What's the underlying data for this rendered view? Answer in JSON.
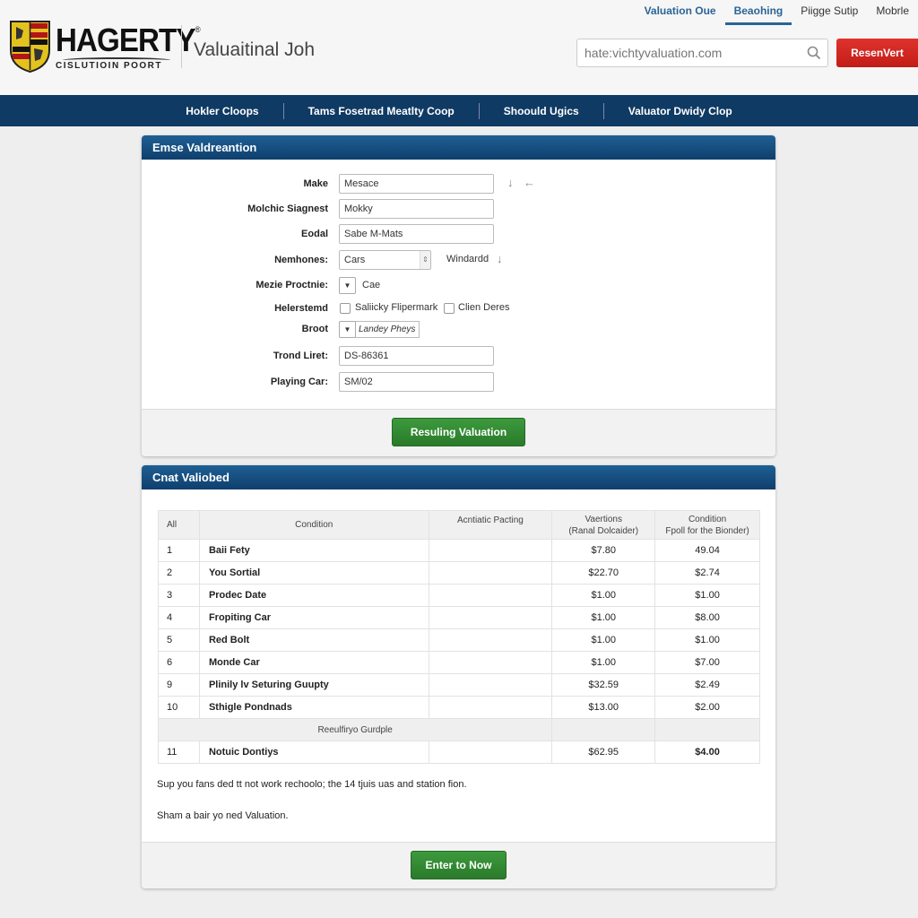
{
  "header": {
    "brand": "HAGERTY",
    "brand_tagline": "CISLUTIOIN POORT",
    "page_title": "Valuaitinal Joh",
    "top_nav": [
      {
        "label": "Valuation Oue"
      },
      {
        "label": "Beaohing",
        "active": true
      },
      {
        "label": "Piigge Sutip"
      },
      {
        "label": "Mobrle"
      }
    ],
    "search": {
      "placeholder": "hate:vichtyvaluation.com",
      "value": ""
    },
    "action_button": "ResenVert"
  },
  "main_nav": [
    "Hokler Cloops",
    "Tams Fosetrad Meatlty Coop",
    "Shoould Ugics",
    "Valuator Dwidy Clop"
  ],
  "form_panel": {
    "title": "Emse Valdreantion",
    "fields": {
      "make": {
        "label": "Make",
        "value": "Mesace"
      },
      "model_stage": {
        "label": "Molchic Siagnest",
        "value": "Mokky"
      },
      "edal": {
        "label": "Eodal",
        "value": "Sabe M-Mats"
      },
      "nemhones": {
        "label": "Nemhones:",
        "value": "Cars",
        "extra_label": "Windardd"
      },
      "mezie_proctnie": {
        "label": "Mezie Proctnie:",
        "value": "Cae"
      },
      "helerstemd": {
        "label": "Helerstemd",
        "options": [
          {
            "label": "Saliicky Flipermark",
            "checked": false
          },
          {
            "label": "Clien Deres",
            "checked": false
          }
        ]
      },
      "broot": {
        "label": "Broot",
        "value": "Landey Pheys"
      },
      "trand_liret": {
        "label": "Trond Liret:",
        "value": "DS-86361"
      },
      "playing_car": {
        "label": "Playing Car:",
        "value": "SM/02"
      }
    },
    "submit_button": "Resuling Valuation"
  },
  "results_panel": {
    "title": "Cnat Valiobed",
    "columns": [
      "All",
      "Condition",
      "Acntiatic Pacting",
      "Vaertions\n(Ranal Dolcaider)",
      "Condition\nFpoll for the Bionder)"
    ],
    "rows": [
      {
        "num": "1",
        "name": "Baii Fety",
        "pacting": "",
        "val1": "$7.80",
        "val2": "49.04"
      },
      {
        "num": "2",
        "name": "You Sortial",
        "pacting": "",
        "val1": "$22.70",
        "val2": "$2.74"
      },
      {
        "num": "3",
        "name": "Prodec Date",
        "pacting": "",
        "val1": "$1.00",
        "val2": "$1.00"
      },
      {
        "num": "4",
        "name": "Fropiting Car",
        "pacting": "",
        "val1": "$1.00",
        "val2": "$8.00"
      },
      {
        "num": "5",
        "name": "Red Bolt",
        "pacting": "",
        "val1": "$1.00",
        "val2": "$1.00"
      },
      {
        "num": "6",
        "name": "Monde Car",
        "pacting": "",
        "val1": "$1.00",
        "val2": "$7.00"
      },
      {
        "num": "9",
        "name": "Plinily lv Seturing Guupty",
        "pacting": "",
        "val1": "$32.59",
        "val2": "$2.49"
      },
      {
        "num": "10",
        "name": "Sthigle Pondnads",
        "pacting": "",
        "val1": "$13.00",
        "val2": "$2.00"
      }
    ],
    "subheader": "Reeulfiryo Gurdple",
    "total_row": {
      "num": "11",
      "name": "Notuic Dontiys",
      "pacting": "",
      "val1": "$62.95",
      "val2": "$4.00"
    },
    "note1": "Sup you fans ded tt not work rechoolo; the 14 tjuis uas and station fion.",
    "note2": "Sham a bair yo ned Valuation.",
    "action_button": "Enter to Now"
  },
  "colors": {
    "nav_blue": "#0f3a63",
    "panel_header_blue": "#1f5f94",
    "accent_red": "#c21d18",
    "button_green": "#2a7a2a",
    "highlight_red_text": "#c0302a"
  }
}
